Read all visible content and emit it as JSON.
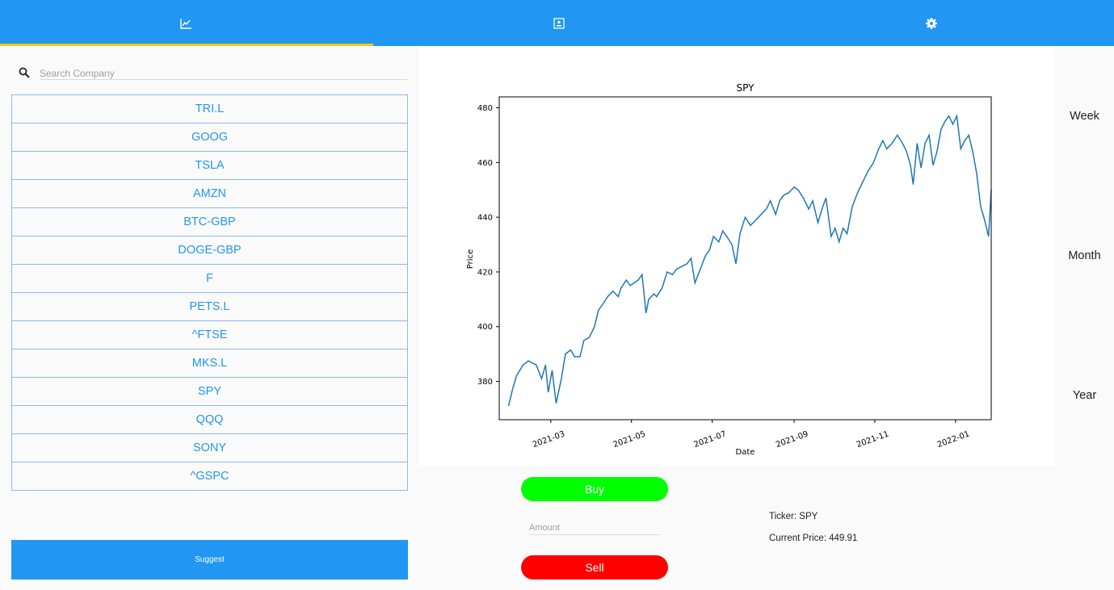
{
  "tabs": [
    {
      "name": "chart",
      "icon": "chart-line-icon"
    },
    {
      "name": "portfolio",
      "icon": "account-box-icon"
    },
    {
      "name": "settings",
      "icon": "gear-icon"
    }
  ],
  "colors": {
    "primary": "#2196f3",
    "indicator": "#f5c518",
    "buy": "#00ff00",
    "sell": "#ff0000",
    "line": "#1f77b4"
  },
  "search": {
    "placeholder": "Search Company"
  },
  "companies": [
    "TRI.L",
    "GOOG",
    "TSLA",
    "AMZN",
    "BTC-GBP",
    "DOGE-GBP",
    "F",
    "PETS.L",
    "^FTSE",
    "MKS.L",
    "SPY",
    "QQQ",
    "SONY",
    "^GSPC"
  ],
  "suggest_label": "Suggest",
  "periods": {
    "week": "Week",
    "month": "Month",
    "year": "Year"
  },
  "trade": {
    "buy_label": "Buy",
    "sell_label": "Sell",
    "amount_placeholder": "Amount"
  },
  "info": {
    "ticker": "Ticker: SPY",
    "current_price": "Current Price: 449.91"
  },
  "chart_data": {
    "type": "line",
    "title": "SPY",
    "xlabel": "Date",
    "ylabel": "Price",
    "ylim": [
      366,
      484
    ],
    "xlim": [
      "2021-01-21",
      "2022-01-28"
    ],
    "y_ticks": [
      380,
      400,
      420,
      440,
      460,
      480
    ],
    "x_ticks": [
      "2021-03",
      "2021-05",
      "2021-07",
      "2021-09",
      "2021-11",
      "2022-01"
    ],
    "x_tick_dates": [
      "2021-03-01",
      "2021-05-01",
      "2021-07-01",
      "2021-09-01",
      "2021-11-01",
      "2022-01-01"
    ],
    "grid": false,
    "series": [
      {
        "color": "#1f77b4",
        "points": [
          [
            "2021-01-28",
            371
          ],
          [
            "2021-01-31",
            377
          ],
          [
            "2021-02-03",
            382
          ],
          [
            "2021-02-08",
            386
          ],
          [
            "2021-02-12",
            387.5
          ],
          [
            "2021-02-18",
            386
          ],
          [
            "2021-02-22",
            381
          ],
          [
            "2021-02-25",
            386
          ],
          [
            "2021-02-27",
            376
          ],
          [
            "2021-03-02",
            384
          ],
          [
            "2021-03-05",
            372
          ],
          [
            "2021-03-09",
            381
          ],
          [
            "2021-03-12",
            390
          ],
          [
            "2021-03-16",
            391.5
          ],
          [
            "2021-03-19",
            389
          ],
          [
            "2021-03-23",
            389
          ],
          [
            "2021-03-26",
            395
          ],
          [
            "2021-03-30",
            396
          ],
          [
            "2021-04-03",
            400
          ],
          [
            "2021-04-06",
            406
          ],
          [
            "2021-04-09",
            408
          ],
          [
            "2021-04-13",
            411
          ],
          [
            "2021-04-17",
            413
          ],
          [
            "2021-04-21",
            411
          ],
          [
            "2021-04-23",
            414
          ],
          [
            "2021-04-27",
            417
          ],
          [
            "2021-04-30",
            415
          ],
          [
            "2021-05-03",
            416
          ],
          [
            "2021-05-06",
            417
          ],
          [
            "2021-05-09",
            419
          ],
          [
            "2021-05-12",
            405
          ],
          [
            "2021-05-14",
            410
          ],
          [
            "2021-05-18",
            412
          ],
          [
            "2021-05-20",
            411
          ],
          [
            "2021-05-24",
            414
          ],
          [
            "2021-05-28",
            420
          ],
          [
            "2021-06-01",
            419
          ],
          [
            "2021-06-04",
            421
          ],
          [
            "2021-06-08",
            422
          ],
          [
            "2021-06-12",
            423
          ],
          [
            "2021-06-15",
            425
          ],
          [
            "2021-06-18",
            416
          ],
          [
            "2021-06-22",
            421
          ],
          [
            "2021-06-26",
            426
          ],
          [
            "2021-06-29",
            428
          ],
          [
            "2021-07-02",
            433
          ],
          [
            "2021-07-06",
            431
          ],
          [
            "2021-07-09",
            435
          ],
          [
            "2021-07-12",
            433
          ],
          [
            "2021-07-16",
            430
          ],
          [
            "2021-07-19",
            423
          ],
          [
            "2021-07-22",
            434
          ],
          [
            "2021-07-26",
            440
          ],
          [
            "2021-07-30",
            437
          ],
          [
            "2021-08-03",
            439
          ],
          [
            "2021-08-07",
            441
          ],
          [
            "2021-08-11",
            443
          ],
          [
            "2021-08-14",
            446
          ],
          [
            "2021-08-18",
            441
          ],
          [
            "2021-08-21",
            446
          ],
          [
            "2021-08-24",
            448
          ],
          [
            "2021-08-28",
            449
          ],
          [
            "2021-09-01",
            451
          ],
          [
            "2021-09-04",
            450
          ],
          [
            "2021-09-08",
            447
          ],
          [
            "2021-09-12",
            443
          ],
          [
            "2021-09-15",
            446
          ],
          [
            "2021-09-19",
            438
          ],
          [
            "2021-09-22",
            443
          ],
          [
            "2021-09-25",
            447
          ],
          [
            "2021-09-29",
            433
          ],
          [
            "2021-10-02",
            436
          ],
          [
            "2021-10-05",
            431
          ],
          [
            "2021-10-08",
            436
          ],
          [
            "2021-10-11",
            434
          ],
          [
            "2021-10-15",
            444
          ],
          [
            "2021-10-19",
            449
          ],
          [
            "2021-10-23",
            453
          ],
          [
            "2021-10-27",
            457
          ],
          [
            "2021-10-31",
            460
          ],
          [
            "2021-11-04",
            465
          ],
          [
            "2021-11-07",
            468
          ],
          [
            "2021-11-10",
            465
          ],
          [
            "2021-11-14",
            467
          ],
          [
            "2021-11-18",
            470
          ],
          [
            "2021-11-22",
            467
          ],
          [
            "2021-11-25",
            464
          ],
          [
            "2021-11-28",
            459
          ],
          [
            "2021-11-30",
            452
          ],
          [
            "2021-12-03",
            467
          ],
          [
            "2021-12-06",
            458
          ],
          [
            "2021-12-09",
            467
          ],
          [
            "2021-12-12",
            470
          ],
          [
            "2021-12-15",
            459
          ],
          [
            "2021-12-18",
            464
          ],
          [
            "2021-12-21",
            472
          ],
          [
            "2021-12-24",
            475
          ],
          [
            "2021-12-27",
            477
          ],
          [
            "2021-12-30",
            474
          ],
          [
            "2022-01-02",
            477
          ],
          [
            "2022-01-05",
            465
          ],
          [
            "2022-01-08",
            468
          ],
          [
            "2022-01-11",
            470
          ],
          [
            "2022-01-14",
            464
          ],
          [
            "2022-01-17",
            456
          ],
          [
            "2022-01-20",
            444
          ],
          [
            "2022-01-23",
            439
          ],
          [
            "2022-01-26",
            433
          ],
          [
            "2022-01-28",
            450
          ]
        ]
      }
    ]
  }
}
